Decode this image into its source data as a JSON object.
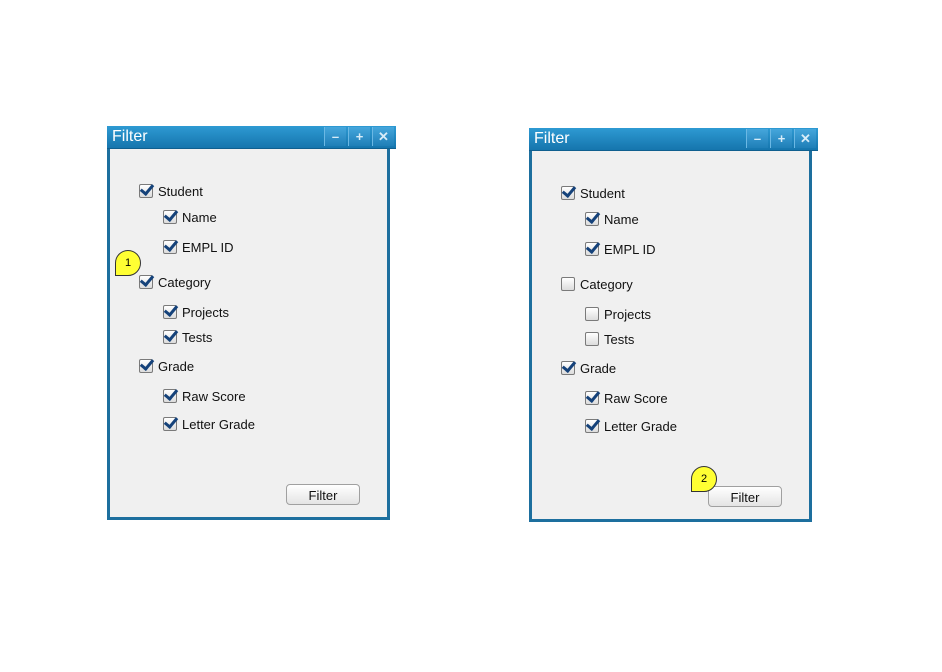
{
  "windows": [
    {
      "title": "Filter",
      "controls": {
        "minimize": "–",
        "maximize": "+",
        "close": "✕"
      },
      "filter_button": "Filter",
      "items": [
        {
          "label": "Student",
          "checked": true
        },
        {
          "label": "Name",
          "checked": true
        },
        {
          "label": "EMPL ID",
          "checked": true
        },
        {
          "label": "Category",
          "checked": true
        },
        {
          "label": "Projects",
          "checked": true
        },
        {
          "label": "Tests",
          "checked": true
        },
        {
          "label": "Grade",
          "checked": true
        },
        {
          "label": "Raw Score",
          "checked": true
        },
        {
          "label": "Letter Grade",
          "checked": true
        }
      ],
      "callout": "1"
    },
    {
      "title": "Filter",
      "controls": {
        "minimize": "–",
        "maximize": "+",
        "close": "✕"
      },
      "filter_button": "Filter",
      "items": [
        {
          "label": "Student",
          "checked": true
        },
        {
          "label": "Name",
          "checked": true
        },
        {
          "label": "EMPL ID",
          "checked": true
        },
        {
          "label": "Category",
          "checked": false
        },
        {
          "label": "Projects",
          "checked": false
        },
        {
          "label": "Tests",
          "checked": false
        },
        {
          "label": "Grade",
          "checked": true
        },
        {
          "label": "Raw Score",
          "checked": true
        },
        {
          "label": "Letter Grade",
          "checked": true
        }
      ],
      "callout": "2"
    }
  ],
  "colors": {
    "titlebar": "#1f82bd",
    "callout": "#ffff33",
    "checkmark": "#15427a"
  }
}
